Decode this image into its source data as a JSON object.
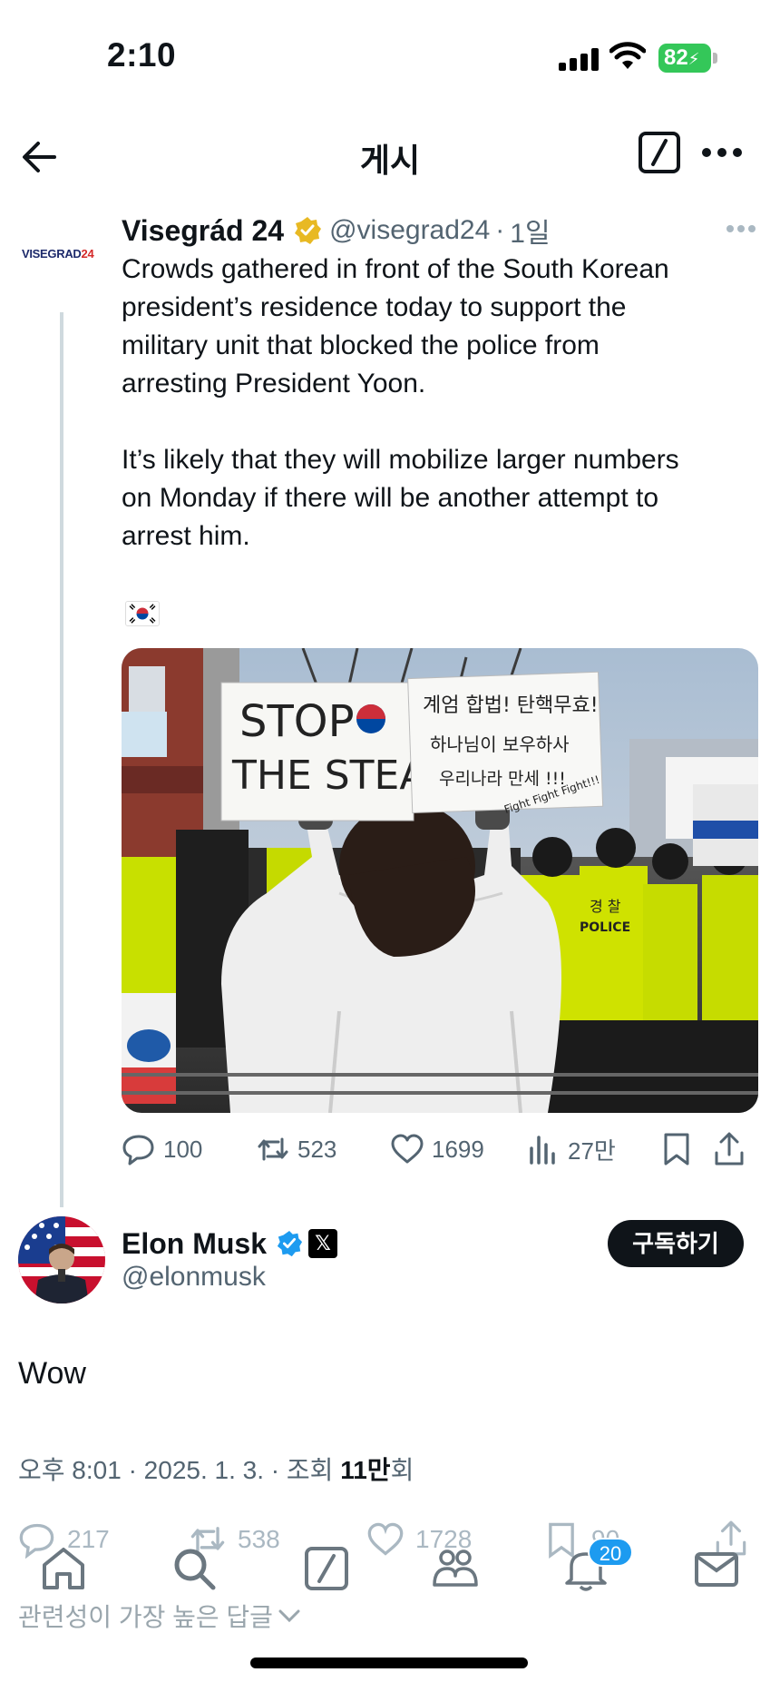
{
  "status_bar": {
    "time": "2:10",
    "battery": "82"
  },
  "nav": {
    "title": "게시"
  },
  "quoted": {
    "avatar_text": "VISEGRAD",
    "avatar_text_red": "24",
    "name": "Visegrád 24",
    "handle": "@visegrad24",
    "separator": "·",
    "time": "1일",
    "text_lines": [
      "Crowds gathered in front of the South Korean",
      "president’s residence today to support the",
      "military unit that blocked the police from",
      "arresting President Yoon.",
      "It’s likely that they will mobilize larger numbers",
      "on Monday if there will be another attempt to",
      "arrest him."
    ],
    "photo": {
      "sign_left_1": "STOP",
      "sign_left_2": "THE STEAL",
      "sign_right_1": "계엄 합법! 탄핵무효!",
      "sign_right_2": "하나님이 보우하사",
      "sign_right_3": "우리나라 만세 !!!",
      "sign_right_4": "Fight Fight Fight!!!",
      "police_vest": "경 찰",
      "police_vest_2": "POLICE"
    },
    "stats": {
      "replies": "100",
      "reposts": "523",
      "likes": "1699",
      "views": "27만"
    }
  },
  "main": {
    "name": "Elon Musk",
    "x_badge": "𝕏",
    "handle": "@elonmusk",
    "subscribe_label": "구독하기",
    "text": "Wow",
    "meta_prefix": "오후 8:01 · 2025. 1. 3. · 조회 ",
    "views_bold": "11만",
    "meta_suffix": "회",
    "stats": {
      "replies": "217",
      "reposts": "538",
      "likes": "1728",
      "bookmarks": "90"
    },
    "replies_sort_label": "관련성이 가장 높은 답글"
  },
  "tabbar": {
    "notifications_badge": "20"
  },
  "colors": {
    "accent": "#1d9bf0",
    "verified_gold": "#e8b923",
    "battery": "#34c759",
    "text": "#0f1419",
    "muted": "#536471"
  }
}
